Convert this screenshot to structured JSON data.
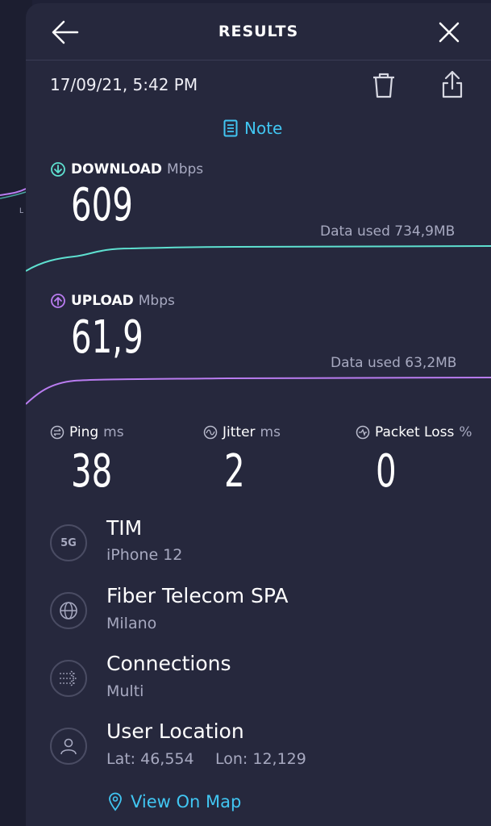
{
  "header": {
    "title": "RESULTS"
  },
  "date": "17/09/21, 5:42 PM",
  "note_label": "Note",
  "download": {
    "label": "DOWNLOAD",
    "unit": "Mbps",
    "value": "609",
    "data_used": "Data used 734,9MB",
    "color": "#5ee0d0"
  },
  "upload": {
    "label": "UPLOAD",
    "unit": "Mbps",
    "value": "61,9",
    "data_used": "Data used 63,2MB",
    "color": "#b97cf0"
  },
  "stats": {
    "ping": {
      "label": "Ping",
      "unit": "ms",
      "value": "38"
    },
    "jitter": {
      "label": "Jitter",
      "unit": "ms",
      "value": "2"
    },
    "packet_loss": {
      "label": "Packet Loss",
      "unit": "%",
      "value": "0"
    }
  },
  "info": {
    "carrier": {
      "badge": "5G",
      "title": "TIM",
      "subtitle": "iPhone 12"
    },
    "provider": {
      "title": "Fiber Telecom SPA",
      "subtitle": "Milano"
    },
    "connections": {
      "title": "Connections",
      "subtitle": "Multi"
    },
    "location": {
      "title": "User Location",
      "lat": "Lat: 46,554",
      "lon": "Lon: 12,129"
    }
  },
  "view_map_label": "View On Map",
  "background": {
    "tick_label": "L"
  },
  "colors": {
    "accent": "#41c6f2",
    "sheet": "#26283d",
    "background": "#1f2136"
  },
  "icons": [
    "back-arrow-icon",
    "close-icon",
    "trash-icon",
    "share-icon",
    "note-icon",
    "download-icon",
    "upload-icon",
    "ping-icon",
    "jitter-icon",
    "packet-loss-icon",
    "5g-icon",
    "globe-icon",
    "connections-icon",
    "user-icon",
    "location-pin-icon"
  ]
}
